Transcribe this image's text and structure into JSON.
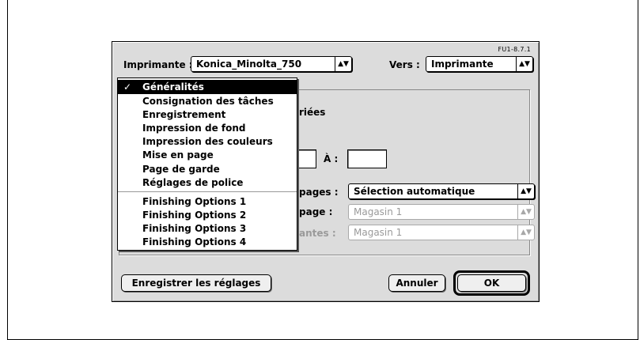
{
  "version": "FU1-8.7.1",
  "header": {
    "printer_label": "Imprimante :",
    "printer_value": "Konica_Minolta_750",
    "dest_label": "Vers :",
    "dest_value": "Imprimante",
    "popup_arrows": "▲▼"
  },
  "menu": {
    "check": "✓",
    "items": [
      {
        "label": "Généralités",
        "selected": true
      },
      {
        "label": "Consignation des tâches"
      },
      {
        "label": "Enregistrement"
      },
      {
        "label": "Impression de fond"
      },
      {
        "label": "Impression des couleurs"
      },
      {
        "label": "Mise en page"
      },
      {
        "label": "Page de garde"
      },
      {
        "label": "Réglages de police"
      },
      {
        "label": "Finishing Options 1"
      },
      {
        "label": "Finishing Options 2"
      },
      {
        "label": "Finishing Options 3"
      },
      {
        "label": "Finishing Options 4"
      }
    ]
  },
  "general": {
    "copies_fragment": "riées",
    "to_label": "À :",
    "to_value": "",
    "from_value": "",
    "paper_source_fragment": "pages :",
    "paper_source_value": "Sélection automatique",
    "first_page_fragment": "page :",
    "first_page_value": "Magasin 1",
    "remaining_fragment": "antes :",
    "remaining_value": "Magasin 1"
  },
  "buttons": {
    "save": "Enregistrer les réglages",
    "cancel": "Annuler",
    "ok": "OK"
  }
}
